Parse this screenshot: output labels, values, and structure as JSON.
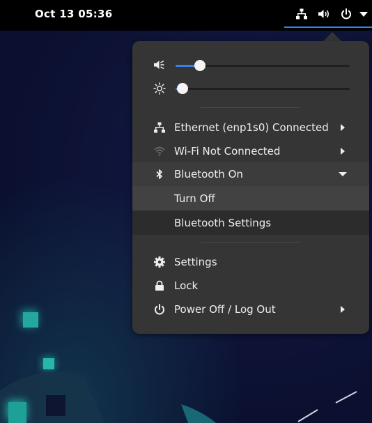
{
  "topbar": {
    "clock": "Oct 13  05:36",
    "icons": [
      "network-wired-icon",
      "volume-icon",
      "power-icon",
      "menu-arrow-icon"
    ],
    "accent": "#3584e4"
  },
  "sliders": {
    "volume": {
      "icon": "volume-low-icon",
      "level": 0.14
    },
    "brightness": {
      "icon": "brightness-icon",
      "level": 0.04
    }
  },
  "menu": {
    "ethernet": {
      "icon": "network-wired-icon",
      "label": "Ethernet (enp1s0) Connected"
    },
    "wifi": {
      "icon": "wifi-icon",
      "label": "Wi-Fi Not Connected"
    },
    "bluetooth": {
      "icon": "bluetooth-icon",
      "label": "Bluetooth On",
      "submenu": {
        "turn_off": "Turn Off",
        "settings": "Bluetooth Settings"
      }
    },
    "settings": {
      "icon": "gear-icon",
      "label": "Settings"
    },
    "lock": {
      "icon": "lock-icon",
      "label": "Lock"
    },
    "power": {
      "icon": "power-icon",
      "label": "Power Off / Log Out"
    }
  },
  "colors": {
    "popover_bg": "#353535",
    "submenu_bg": "#2c2c2c",
    "hover_bg": "#424242",
    "desktop_bg": "#0b1030"
  }
}
